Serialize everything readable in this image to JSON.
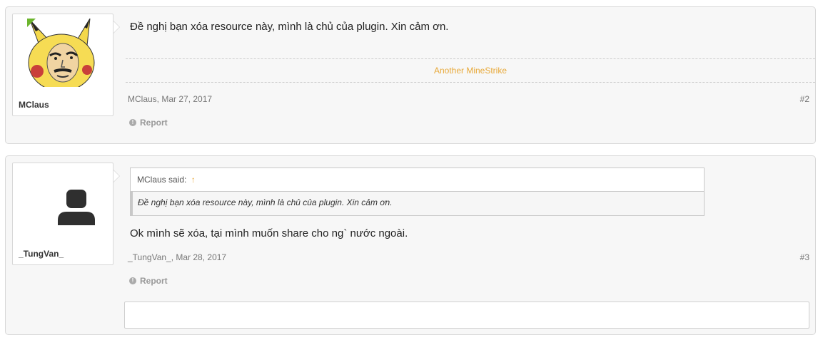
{
  "posts": [
    {
      "username": "MClaus",
      "avatar": "pikachu-meme-avatar",
      "message": "Đề nghị bạn xóa resource này, mình là chủ của plugin. Xin cảm ơn.",
      "resource_link": "Another MineStrike",
      "author_date": "MClaus, Mar 27, 2017",
      "post_number": "#2",
      "report_label": "Report"
    },
    {
      "username": "_TungVan_",
      "avatar": "default-user-avatar",
      "quote": {
        "author": "MClaus said:",
        "arrow": "↑",
        "text": "Đề nghị bạn xóa resource này, mình là chủ của plugin. Xin cảm ơn."
      },
      "message": "Ok mình sẽ xóa, tại mình muốn share cho ng` nước ngoài.",
      "author_date": "_TungVan_, Mar 28, 2017",
      "post_number": "#3",
      "report_label": "Report"
    }
  ],
  "colors": {
    "accent": "#e8a93a",
    "post_bg": "#f7f7f7",
    "border": "#d8d8d8",
    "staff_badge": "#6cb52d"
  }
}
